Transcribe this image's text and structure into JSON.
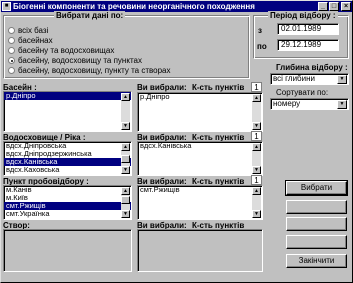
{
  "window": {
    "title": "Біогенні компоненти та речовини неорганічного походження",
    "minimize": "_",
    "maximize": "□",
    "close": "×"
  },
  "selection_group": {
    "title": "Вибрати дані по:",
    "options": [
      {
        "label": "всіх базі",
        "selected": false
      },
      {
        "label": "басейнах",
        "selected": false
      },
      {
        "label": "басейну та водосховищах",
        "selected": false
      },
      {
        "label": "басейну, водосховищу та пунктах",
        "selected": true
      },
      {
        "label": "басейну, водосховищу, пункту та створах",
        "selected": false
      }
    ]
  },
  "period": {
    "title": "Період відбору :",
    "from_label": "з",
    "from_value": "02.01.1989",
    "to_label": "по",
    "to_value": "29.12.1989"
  },
  "basin": {
    "label": "Басейн :",
    "items": [
      {
        "text": "р.Дніпро",
        "selected": true
      }
    ],
    "chosen_label": "Ви вибрали:",
    "count_label": "К-сть пунктів",
    "count": "1",
    "chosen": [
      "р.Дніпро"
    ]
  },
  "reservoir": {
    "label": "Водосховище / Ріка :",
    "items": [
      {
        "text": "вдсх.Дніпровська",
        "selected": false
      },
      {
        "text": "вдсх.Дніпродзержинська",
        "selected": false
      },
      {
        "text": "вдсх.Канівська",
        "selected": true
      },
      {
        "text": "вдсх.Каховська",
        "selected": false
      }
    ],
    "chosen_label": "Ви вибрали:",
    "count_label": "К-сть пунктів",
    "count": "1",
    "chosen": [
      "вдсх.Канівська"
    ]
  },
  "sampling_point": {
    "label": "Пункт пробовідбору :",
    "items": [
      {
        "text": "м.Канів",
        "selected": false
      },
      {
        "text": "м.Київ",
        "selected": false
      },
      {
        "text": "смт.Ржищів",
        "selected": true
      },
      {
        "text": "смт.Українка",
        "selected": false
      }
    ],
    "chosen_label": "Ви вибрали:",
    "count_label": "К-сть пунктів",
    "count": "1",
    "chosen": [
      "смт.Ржищів"
    ]
  },
  "section": {
    "label": "Створ:",
    "chosen_label": "Ви вибрали:",
    "count_label": "К-сть пунктів"
  },
  "depth": {
    "title": "Глибина відбору :",
    "value": "всі глибини",
    "sort_label": "Сортувати по:",
    "sort_value": "номеру"
  },
  "buttons": [
    {
      "label": "Вибрати",
      "enabled": true
    },
    {
      "label": "",
      "enabled": false
    },
    {
      "label": "",
      "enabled": false
    },
    {
      "label": "",
      "enabled": false
    },
    {
      "label": "Закінчити",
      "enabled": true
    }
  ]
}
